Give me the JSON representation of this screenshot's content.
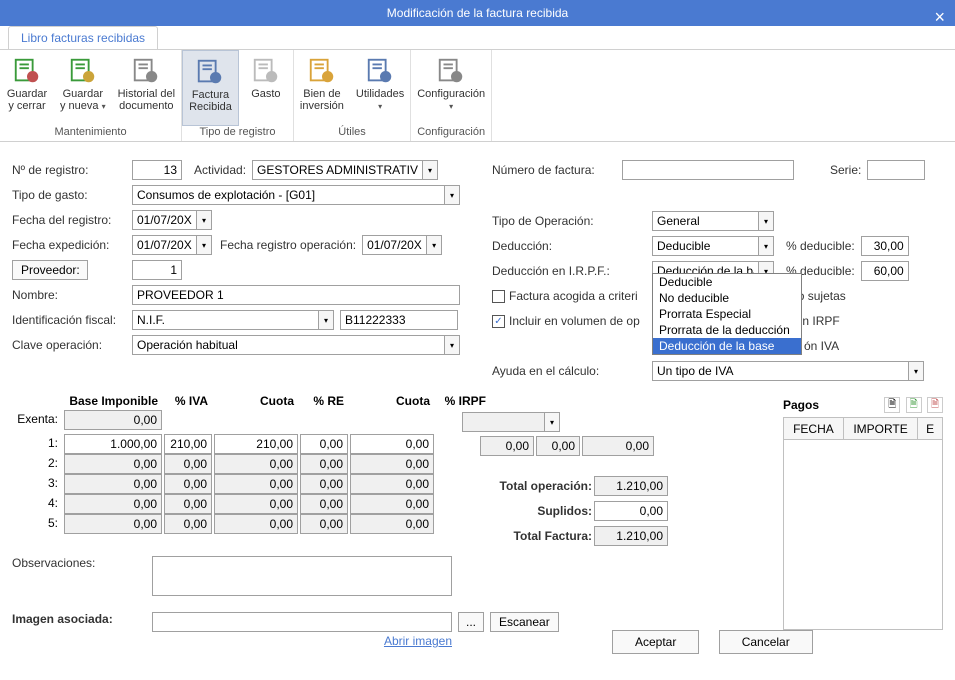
{
  "title": "Modificación de la factura recibida",
  "tab": "Libro facturas recibidas",
  "ribbon": {
    "groups": [
      {
        "label": "Mantenimiento",
        "items": [
          {
            "name": "guardar-cerrar",
            "l1": "Guardar",
            "l2": "y cerrar"
          },
          {
            "name": "guardar-nueva",
            "l1": "Guardar",
            "l2": "y nueva",
            "arrow": true
          },
          {
            "name": "historial",
            "l1": "Historial del",
            "l2": "documento"
          }
        ]
      },
      {
        "label": "Tipo de registro",
        "items": [
          {
            "name": "factura-recibida",
            "l1": "Factura",
            "l2": "Recibida",
            "active": true
          },
          {
            "name": "gasto",
            "l1": "Gasto",
            "l2": ""
          }
        ]
      },
      {
        "label": "Útiles",
        "items": [
          {
            "name": "bien-inversion",
            "l1": "Bien de",
            "l2": "inversión"
          },
          {
            "name": "utilidades",
            "l1": "Utilidades",
            "l2": "",
            "arrow": true
          }
        ]
      },
      {
        "label": "Configuración",
        "items": [
          {
            "name": "configuracion",
            "l1": "Configuración",
            "l2": "",
            "arrow": true
          }
        ]
      }
    ]
  },
  "labels": {
    "nregistro": "Nº de registro:",
    "actividad": "Actividad:",
    "tipogasto": "Tipo de gasto:",
    "fecharegistro": "Fecha del registro:",
    "fechaexpedicion": "Fecha expedición:",
    "fecharegop": "Fecha registro operación:",
    "proveedor": "Proveedor:",
    "nombre": "Nombre:",
    "idfiscal": "Identificación fiscal:",
    "claveop": "Clave operación:",
    "numfactura": "Número de factura:",
    "serie": "Serie:",
    "tipoop": "Tipo de Operación:",
    "deduccion": "Deducción:",
    "deduccionirpf": "Deducción en I.R.P.F.:",
    "pctdeducible": "% deducible:",
    "facturacaja": "Factura acogida a criteri",
    "incluirvolumen": "Incluir en  volumen de op",
    "ayudacalculo": "Ayuda en el cálculo:",
    "observaciones": "Observaciones:",
    "imagenasociada": "Imagen asociada:",
    "abririmagen": "Abrir imagen",
    "escanear": "Escanear",
    "aceptar": "Aceptar",
    "cancelar": "Cancelar",
    "pagos": "Pagos",
    "exenta": "Exenta:",
    "totalop": "Total operación:",
    "suplidos": "Suplidos:",
    "totalfactura": "Total Factura:",
    "ellipsis": "...",
    "nosujetas_tail": "o sujetas",
    "irpf_tail": "ón IRPF",
    "iva_tail": "ón IVA"
  },
  "values": {
    "nregistro": "13",
    "actividad": "GESTORES ADMINISTRATIVOS",
    "tipogasto": "Consumos de explotación - [G01]",
    "fecharegistro": "01/07/20XX",
    "fechaexpedicion": "01/07/20XX",
    "fecharegop": "01/07/20XX",
    "proveedor": "1",
    "nombre": "PROVEEDOR 1",
    "idfiscal_tipo": "N.I.F.",
    "idfiscal_num": "B11222333",
    "claveop": "Operación habitual",
    "tipoop": "General",
    "deduccion": "Deducible",
    "deduccionirpf": "Deducción de la base",
    "pctded1": "30,00",
    "pctded2": "60,00",
    "ayudacalculo": "Un tipo de IVA",
    "totalop": "1.210,00",
    "suplidos": "0,00",
    "totalfactura": "1.210,00"
  },
  "dropdown_irpf": {
    "opts": [
      "Deducible",
      "No deducible",
      "Prorrata Especial",
      "Prorrata de la deducción",
      "Deducción de la base"
    ],
    "selected": 4
  },
  "gridhead": {
    "base": "Base Imponible",
    "iva": "% IVA",
    "cuota": "Cuota",
    "re": "% RE",
    "cuota2": "Cuota",
    "irpf": "% IRPF"
  },
  "gridrows": [
    {
      "n": "1:",
      "base": "1.000,00",
      "iva": "210,00",
      "cuota": "210,00",
      "re": "0,00",
      "cuota2": "0,00"
    },
    {
      "n": "2:",
      "base": "0,00",
      "iva": "0,00",
      "cuota": "0,00",
      "re": "0,00",
      "cuota2": "0,00"
    },
    {
      "n": "3:",
      "base": "0,00",
      "iva": "0,00",
      "cuota": "0,00",
      "re": "0,00",
      "cuota2": "0,00"
    },
    {
      "n": "4:",
      "base": "0,00",
      "iva": "0,00",
      "cuota": "0,00",
      "re": "0,00",
      "cuota2": "0,00"
    },
    {
      "n": "5:",
      "base": "0,00",
      "iva": "0,00",
      "cuota": "0,00",
      "re": "0,00",
      "cuota2": "0,00"
    }
  ],
  "exenta": "0,00",
  "irpfblock": {
    "v1": "0,00",
    "v2": "0,00",
    "v3": "0,00"
  },
  "pagoshead": {
    "fecha": "FECHA",
    "importe": "IMPORTE",
    "e": "E"
  }
}
